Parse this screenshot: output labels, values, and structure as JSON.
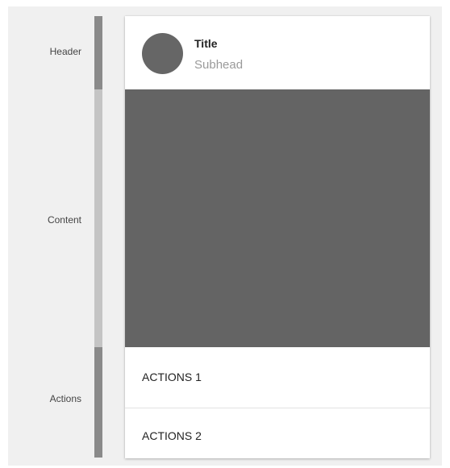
{
  "regions": {
    "header": {
      "label": "Header",
      "bar_color": "#8a8a8a"
    },
    "content": {
      "label": "Content",
      "bar_color": "#c4c4c4"
    },
    "actions": {
      "label": "Actions",
      "bar_color": "#8a8a8a"
    }
  },
  "card": {
    "title": "Title",
    "subhead": "Subhead",
    "avatar_color": "#666666",
    "media_color": "#646464",
    "actions": [
      "ACTIONS 1",
      "ACTIONS 2"
    ]
  },
  "colors": {
    "stage_background": "#f0f0f0",
    "card_background": "#ffffff"
  }
}
